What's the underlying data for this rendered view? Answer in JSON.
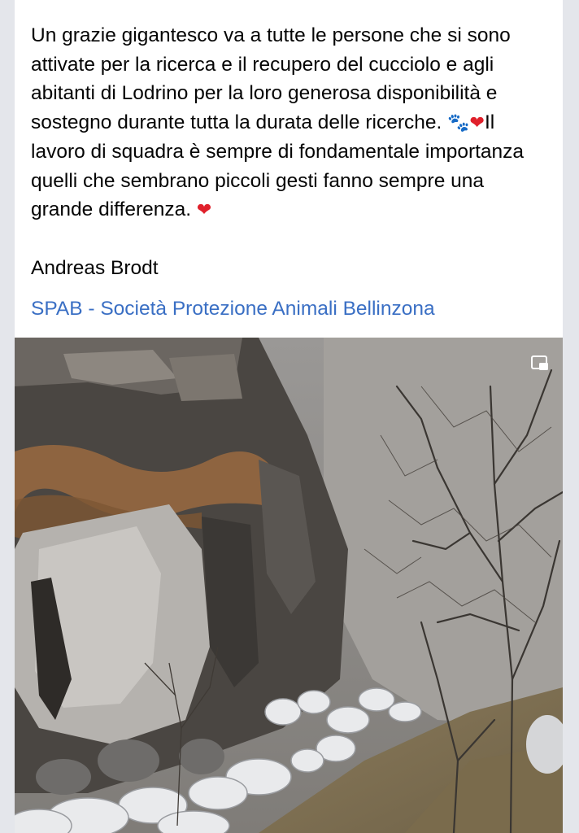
{
  "post": {
    "paragraph1_a": "Un grazie gigantesco va a tutte le persone che si sono attivate per la ricerca e il recupero del cucciolo e agli abitanti di Lodrino per la loro generosa disponibilità e sostegno durante tutta la durata delle ricerche. ",
    "paw_emoji": "🐾",
    "heart_emoji_1": "❤",
    "paragraph1_b": "Il lavoro di squadra è sempre di fondamentale importanza quelli che sembrano piccoli gesti fanno sempre una grande differenza. ",
    "heart_emoji_2": "❤",
    "signature": "Andreas Brodt",
    "link_text": "SPAB - Società Protezione Animali Bellinzona"
  },
  "photo": {
    "icon": "picture-in-picture-icon"
  },
  "colors": {
    "link": "#3a6fc4",
    "text": "#050505",
    "heart": "#e0202b",
    "background": "#e4e6eb"
  }
}
